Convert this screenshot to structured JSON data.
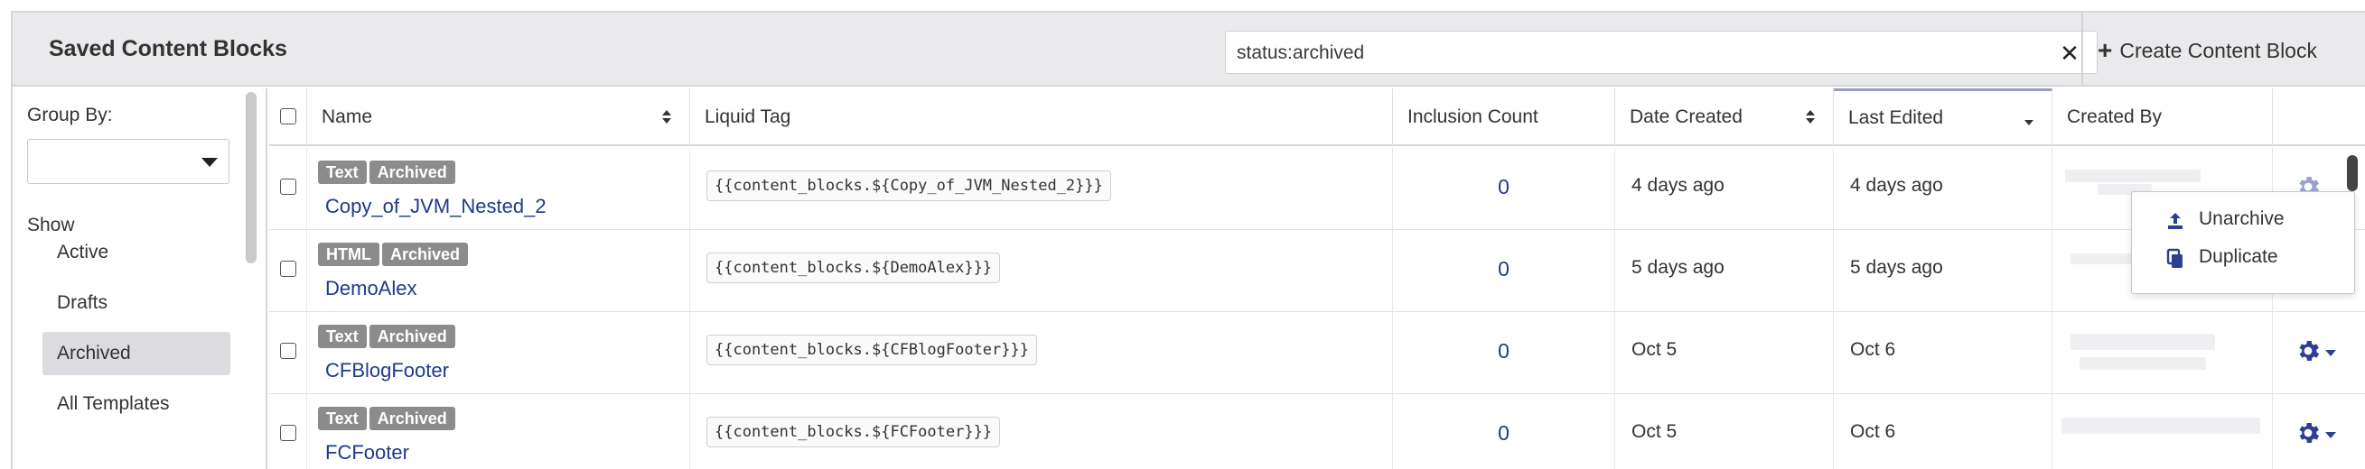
{
  "header": {
    "title": "Saved Content Blocks",
    "search_value": "status:archived",
    "clear_icon": "close-icon",
    "create_label": "Create Content Block"
  },
  "sidebar": {
    "group_by_label": "Group By:",
    "group_by_value": "",
    "show_label": "Show",
    "items": [
      {
        "label": "Active",
        "active": false
      },
      {
        "label": "Drafts",
        "active": false
      },
      {
        "label": "Archived",
        "active": true
      },
      {
        "label": "All Templates",
        "active": false
      }
    ]
  },
  "table": {
    "columns": [
      "Name",
      "Liquid Tag",
      "Inclusion Count",
      "Date Created",
      "Last Edited",
      "Created By"
    ],
    "sorted_column": "Last Edited",
    "rows": [
      {
        "type": "Text",
        "status": "Archived",
        "name": "Copy_of_JVM_Nested_2",
        "tag": "{{content_blocks.${Copy_of_JVM_Nested_2}}}",
        "count": "0",
        "created": "4 days ago",
        "edited": "4 days ago"
      },
      {
        "type": "HTML",
        "status": "Archived",
        "name": "DemoAlex",
        "tag": "{{content_blocks.${DemoAlex}}}",
        "count": "0",
        "created": "5 days ago",
        "edited": "5 days ago"
      },
      {
        "type": "Text",
        "status": "Archived",
        "name": "CFBlogFooter",
        "tag": "{{content_blocks.${CFBlogFooter}}}",
        "count": "0",
        "created": "Oct 5",
        "edited": "Oct 6"
      },
      {
        "type": "Text",
        "status": "Archived",
        "name": "FCFooter",
        "tag": "{{content_blocks.${FCFooter}}}",
        "count": "0",
        "created": "Oct 5",
        "edited": "Oct 6"
      }
    ]
  },
  "menu": {
    "items": [
      {
        "label": "Unarchive",
        "icon": "upload-icon"
      },
      {
        "label": "Duplicate",
        "icon": "copy-icon"
      }
    ]
  },
  "colors": {
    "link": "#1f3a8a",
    "badge": "#8c8c8c",
    "header_bg": "#eaeaec",
    "selected_item": "#dcdce0"
  }
}
